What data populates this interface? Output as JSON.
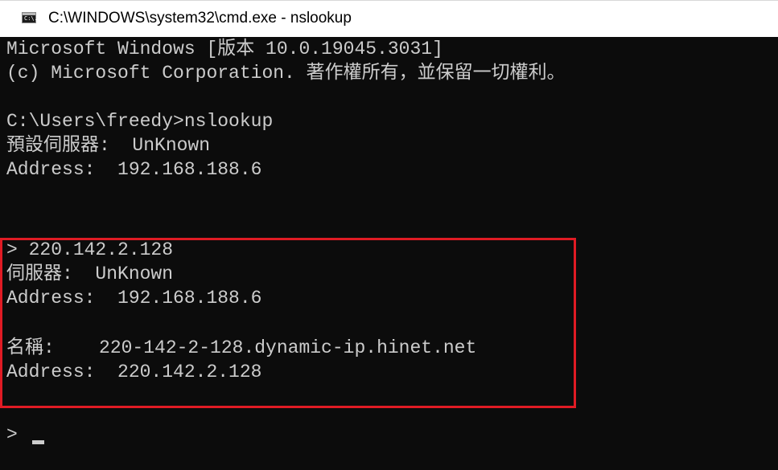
{
  "window": {
    "title": "C:\\WINDOWS\\system32\\cmd.exe - nslookup",
    "icon": "cmd-window-icon",
    "icon_glyph": "C:\\."
  },
  "console": {
    "lines": [
      "Microsoft Windows [版本 10.0.19045.3031]",
      "(c) Microsoft Corporation. 著作權所有，並保留一切權利。",
      "",
      "C:\\Users\\freedy>nslookup",
      "預設伺服器:  UnKnown",
      "Address:  192.168.188.6",
      "",
      "> 220.142.2.128",
      "伺服器:  UnKnown",
      "Address:  192.168.188.6",
      "",
      "名稱:    220-142-2-128.dynamic-ip.hinet.net",
      "Address:  220.142.2.128",
      "",
      ">"
    ]
  },
  "colors": {
    "console_bg": "#0c0c0c",
    "console_text": "#cccccc",
    "highlight_border": "#e01b24"
  }
}
